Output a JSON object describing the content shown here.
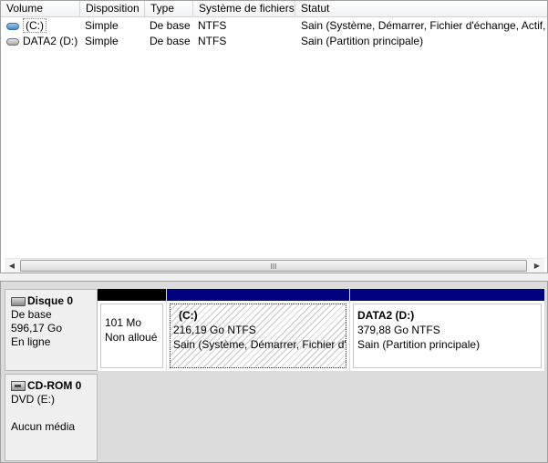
{
  "list": {
    "columns": [
      "Volume",
      "Disposition",
      "Type",
      "Système de fichiers",
      "Statut"
    ],
    "rows": [
      {
        "volume": "(C:)",
        "disposition": "Simple",
        "type": "De base",
        "fs": "NTFS",
        "status": "Sain (Système, Démarrer, Fichier d'échange, Actif, V",
        "icon": "blue-volume-icon"
      },
      {
        "volume": "DATA2 (D:)",
        "disposition": "Simple",
        "type": "De base",
        "fs": "NTFS",
        "status": "Sain (Partition principale)",
        "icon": "gray-volume-icon"
      }
    ],
    "scroll_grip": "III"
  },
  "disks": {
    "disk0": {
      "title": "Disque 0",
      "type": "De base",
      "size": "596,17 Go",
      "state": "En ligne",
      "partitions": [
        {
          "size": "101 Mo",
          "status": "Non alloué"
        },
        {
          "name": "(C:)",
          "size": "216,19 Go NTFS",
          "status": "Sain (Système, Démarrer, Fichier d'é"
        },
        {
          "name": "DATA2  (D:)",
          "size": "379,88 Go NTFS",
          "status": "Sain (Partition principale)"
        }
      ]
    },
    "cdrom0": {
      "title": "CD-ROM 0",
      "drive": "DVD (E:)",
      "media": "Aucun média"
    }
  },
  "colors": {
    "unallocated_bar": "#000000",
    "primary_bar": "#00007f"
  }
}
